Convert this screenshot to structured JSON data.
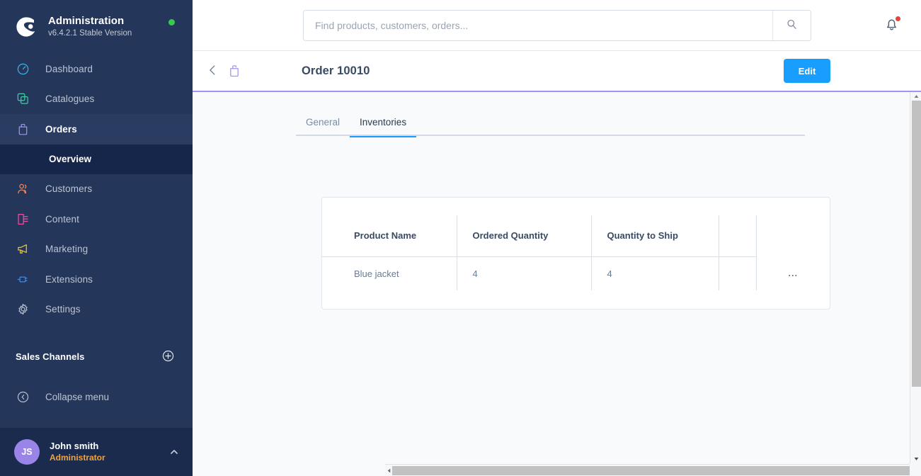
{
  "sidebar": {
    "brand": {
      "title": "Administration",
      "version": "v6.4.2.1 Stable Version",
      "status_dot_color": "#37CA4C",
      "logo_icon": "shopware-logo-icon"
    },
    "items": [
      {
        "label": "Dashboard",
        "icon": "dashboard-icon",
        "color": "#37B6E8",
        "active": false
      },
      {
        "label": "Catalogues",
        "icon": "catalogues-icon",
        "color": "#3ECFA0",
        "active": false
      },
      {
        "label": "Orders",
        "icon": "orders-bag-icon",
        "color": "#A193F2",
        "active": true
      },
      {
        "label": "Customers",
        "icon": "customers-icon",
        "color": "#EE8A5E",
        "active": false
      },
      {
        "label": "Content",
        "icon": "content-icon",
        "color": "#EE4FA0",
        "active": false
      },
      {
        "label": "Marketing",
        "icon": "marketing-megaphone-icon",
        "color": "#EDC33A",
        "active": false
      },
      {
        "label": "Extensions",
        "icon": "extensions-plug-icon",
        "color": "#3A8CF0",
        "active": false
      },
      {
        "label": "Settings",
        "icon": "settings-gear-icon",
        "color": "#B6C1D1",
        "active": false
      }
    ],
    "sub_item": {
      "label": "Overview",
      "parent": "Orders"
    },
    "section": {
      "title": "Sales Channels",
      "add_icon": "plus-circle-icon"
    },
    "collapse": {
      "label": "Collapse menu",
      "icon": "collapse-chevron-icon"
    },
    "user": {
      "initials": "JS",
      "name": "John smith",
      "role": "Administrator",
      "avatar_color": "#9A84E8",
      "role_color": "#F2A33C",
      "caret_icon": "chevron-up-icon"
    }
  },
  "topbar": {
    "search": {
      "placeholder": "Find products, customers, orders...",
      "value": "",
      "icon": "search-icon"
    },
    "notifications": {
      "icon": "bell-icon",
      "badge_visible": true,
      "badge_color": "#E3453E"
    }
  },
  "pagehead": {
    "back_icon": "chevron-left-icon",
    "entity_icon": "orders-bag-icon",
    "title": "Order 10010",
    "edit_label": "Edit",
    "accent_color": "#189EFF",
    "underline_color": "#A193F2"
  },
  "tabs": [
    {
      "label": "General",
      "active": false
    },
    {
      "label": "Inventories",
      "active": true
    }
  ],
  "table": {
    "columns": [
      "Product Name",
      "Ordered Quantity",
      "Quantity to Ship",
      "",
      ""
    ],
    "rows": [
      {
        "product_name": "Blue jacket",
        "ordered_quantity": "4",
        "quantity_to_ship": "4",
        "extra": "",
        "actions_icon": "ellipsis-icon",
        "actions_label": "..."
      }
    ]
  },
  "scrollbars": {
    "vertical_icon_up": "scroll-up-arrow-icon",
    "vertical_icon_down": "scroll-down-arrow-icon",
    "horizontal_icon_left": "scroll-left-arrow-icon",
    "horizontal_icon_right": "scroll-right-arrow-icon"
  }
}
